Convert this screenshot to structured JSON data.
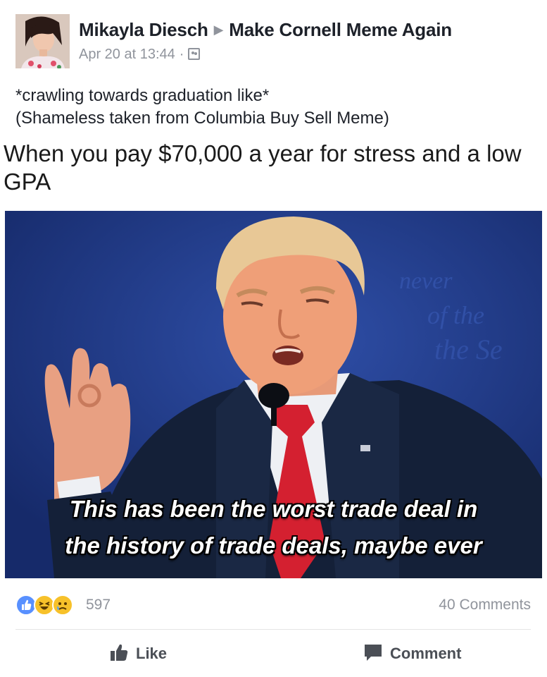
{
  "post": {
    "author": "Mikayla Diesch",
    "group": "Make Cornell Meme Again",
    "timestamp": "Apr 20 at 13:44",
    "separator": "·",
    "audience_icon": "group-audience-icon",
    "caption_line1": "*crawling towards graduation like*",
    "caption_line2": "(Shameless taken from Columbia Buy Sell Meme)"
  },
  "meme": {
    "top_text": "When you pay $70,000 a year for stress and a low GPA",
    "subtitle_line1": "This has been the worst trade deal in",
    "subtitle_line2": "the history of trade deals, maybe ever"
  },
  "stats": {
    "reaction_icons": [
      "like-reaction-icon",
      "haha-reaction-icon",
      "sad-reaction-icon"
    ],
    "reaction_count": "597",
    "comments_count": "40 Comments"
  },
  "actions": {
    "like_label": "Like",
    "comment_label": "Comment"
  },
  "colors": {
    "like_blue": "#5890ff",
    "meta_gray": "#90949c",
    "backdrop_blue": "#203a85",
    "tie_red": "#d42030"
  }
}
